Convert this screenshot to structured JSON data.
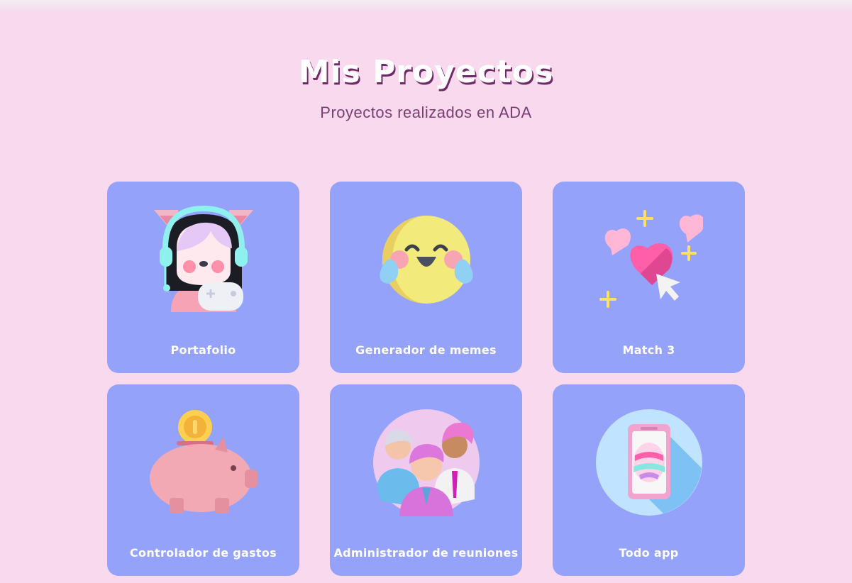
{
  "header": {
    "title": "Mis Proyectos",
    "subtitle": "Proyectos realizados en ADA"
  },
  "colors": {
    "background": "#f8d9ee",
    "card": "#95a2fa",
    "title_shadow": "#6d2a66",
    "subtitle": "#7a3f72"
  },
  "projects": [
    {
      "label": "Portafolio",
      "icon": "gamer-girl-icon"
    },
    {
      "label": "Generador de memes",
      "icon": "laughing-emoji-icon"
    },
    {
      "label": "Match 3",
      "icon": "hearts-cursor-icon"
    },
    {
      "label": "Controlador de gastos",
      "icon": "piggy-bank-icon"
    },
    {
      "label": "Administrador de reuniones",
      "icon": "meeting-people-icon"
    },
    {
      "label": "Todo app",
      "icon": "phone-egg-icon"
    }
  ]
}
